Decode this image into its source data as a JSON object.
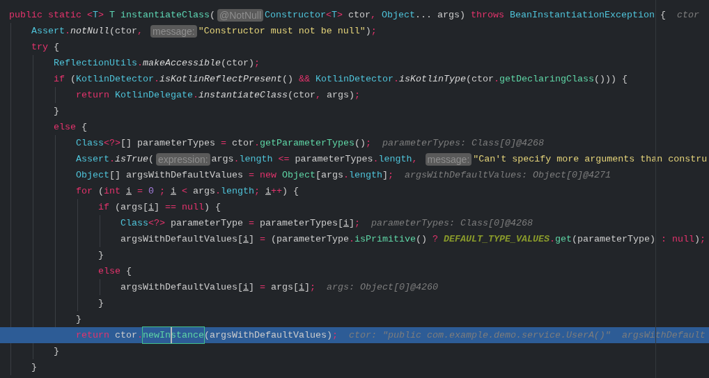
{
  "editor": {
    "lines": [
      {
        "current": false,
        "tokens": [
          {
            "kind": "kw",
            "text": "public static "
          },
          {
            "kind": "punct",
            "text": "<"
          },
          {
            "kind": "type",
            "text": "T"
          },
          {
            "kind": "punct",
            "text": "> "
          },
          {
            "kind": "decl",
            "text": "T instantiateClass"
          },
          {
            "kind": "plain",
            "text": "("
          },
          {
            "kind": "hint",
            "text": "@NotNull"
          },
          {
            "kind": "type",
            "text": "Constructor"
          },
          {
            "kind": "punct",
            "text": "<"
          },
          {
            "kind": "type",
            "text": "T"
          },
          {
            "kind": "punct",
            "text": "> "
          },
          {
            "kind": "plain",
            "text": "ctor"
          },
          {
            "kind": "punct",
            "text": ", "
          },
          {
            "kind": "type",
            "text": "Object"
          },
          {
            "kind": "plain",
            "text": "... args) "
          },
          {
            "kind": "kw",
            "text": "throws "
          },
          {
            "kind": "type",
            "text": "BeanInstantiationException"
          },
          {
            "kind": "plain",
            "text": " {"
          },
          {
            "kind": "debug",
            "text": "ctor"
          }
        ],
        "children": [
          {
            "current": false,
            "tokens": [
              {
                "kind": "type",
                "text": "Assert"
              },
              {
                "kind": "punct",
                "text": "."
              },
              {
                "kind": "static",
                "text": "notNull"
              },
              {
                "kind": "plain",
                "text": "(ctor"
              },
              {
                "kind": "punct",
                "text": ", "
              },
              {
                "kind": "hint",
                "text": "message:"
              },
              {
                "kind": "string",
                "text": "\"Constructor must not be null\""
              },
              {
                "kind": "plain",
                "text": ")"
              },
              {
                "kind": "punct",
                "text": ";"
              }
            ]
          },
          {
            "current": false,
            "tokens": [
              {
                "kind": "kw",
                "text": "try "
              },
              {
                "kind": "plain",
                "text": "{"
              }
            ],
            "children": [
              {
                "current": false,
                "tokens": [
                  {
                    "kind": "type",
                    "text": "ReflectionUtils"
                  },
                  {
                    "kind": "punct",
                    "text": "."
                  },
                  {
                    "kind": "static",
                    "text": "makeAccessible"
                  },
                  {
                    "kind": "plain",
                    "text": "(ctor)"
                  },
                  {
                    "kind": "punct",
                    "text": ";"
                  }
                ]
              },
              {
                "current": false,
                "tokens": [
                  {
                    "kind": "kw",
                    "text": "if "
                  },
                  {
                    "kind": "plain",
                    "text": "("
                  },
                  {
                    "kind": "type",
                    "text": "KotlinDetector"
                  },
                  {
                    "kind": "punct",
                    "text": "."
                  },
                  {
                    "kind": "static",
                    "text": "isKotlinReflectPresent"
                  },
                  {
                    "kind": "plain",
                    "text": "() "
                  },
                  {
                    "kind": "kw",
                    "text": "&& "
                  },
                  {
                    "kind": "type",
                    "text": "KotlinDetector"
                  },
                  {
                    "kind": "punct",
                    "text": "."
                  },
                  {
                    "kind": "static",
                    "text": "isKotlinType"
                  },
                  {
                    "kind": "plain",
                    "text": "(ctor"
                  },
                  {
                    "kind": "punct",
                    "text": "."
                  },
                  {
                    "kind": "method",
                    "text": "getDeclaringClass"
                  },
                  {
                    "kind": "plain",
                    "text": "())) {"
                  }
                ],
                "children": [
                  {
                    "current": false,
                    "tokens": [
                      {
                        "kind": "kw",
                        "text": "return "
                      },
                      {
                        "kind": "type",
                        "text": "KotlinDelegate"
                      },
                      {
                        "kind": "punct",
                        "text": "."
                      },
                      {
                        "kind": "static",
                        "text": "instantiateClass"
                      },
                      {
                        "kind": "plain",
                        "text": "(ctor"
                      },
                      {
                        "kind": "punct",
                        "text": ", "
                      },
                      {
                        "kind": "plain",
                        "text": "args)"
                      },
                      {
                        "kind": "punct",
                        "text": ";"
                      }
                    ]
                  }
                ]
              },
              {
                "current": false,
                "tokens": [
                  {
                    "kind": "plain",
                    "text": "}"
                  }
                ]
              },
              {
                "current": false,
                "tokens": [
                  {
                    "kind": "kw",
                    "text": "else "
                  },
                  {
                    "kind": "plain",
                    "text": "{"
                  }
                ],
                "children": [
                  {
                    "current": false,
                    "tokens": [
                      {
                        "kind": "type",
                        "text": "Class"
                      },
                      {
                        "kind": "punct",
                        "text": "<?>"
                      },
                      {
                        "kind": "plain",
                        "text": "[] parameterTypes "
                      },
                      {
                        "kind": "punct",
                        "text": "= "
                      },
                      {
                        "kind": "plain",
                        "text": "ctor"
                      },
                      {
                        "kind": "punct",
                        "text": "."
                      },
                      {
                        "kind": "method",
                        "text": "getParameterTypes"
                      },
                      {
                        "kind": "plain",
                        "text": "()"
                      },
                      {
                        "kind": "punct",
                        "text": ";"
                      },
                      {
                        "kind": "debug",
                        "text": "parameterTypes: Class[0]@4268"
                      }
                    ]
                  },
                  {
                    "current": false,
                    "tokens": [
                      {
                        "kind": "type",
                        "text": "Assert"
                      },
                      {
                        "kind": "punct",
                        "text": "."
                      },
                      {
                        "kind": "static",
                        "text": "isTrue"
                      },
                      {
                        "kind": "plain",
                        "text": "("
                      },
                      {
                        "kind": "hint",
                        "text": "expression:"
                      },
                      {
                        "kind": "plain",
                        "text": "args"
                      },
                      {
                        "kind": "punct",
                        "text": "."
                      },
                      {
                        "kind": "field",
                        "text": "length "
                      },
                      {
                        "kind": "punct",
                        "text": "<= "
                      },
                      {
                        "kind": "plain",
                        "text": "parameterTypes"
                      },
                      {
                        "kind": "punct",
                        "text": "."
                      },
                      {
                        "kind": "field",
                        "text": "length"
                      },
                      {
                        "kind": "punct",
                        "text": ", "
                      },
                      {
                        "kind": "hint",
                        "text": "message:"
                      },
                      {
                        "kind": "string",
                        "text": "\"Can't specify more arguments than constru"
                      }
                    ]
                  },
                  {
                    "current": false,
                    "tokens": [
                      {
                        "kind": "type",
                        "text": "Object"
                      },
                      {
                        "kind": "plain",
                        "text": "[] argsWithDefaultValues "
                      },
                      {
                        "kind": "punct",
                        "text": "= "
                      },
                      {
                        "kind": "kw",
                        "text": "new "
                      },
                      {
                        "kind": "method",
                        "text": "Object"
                      },
                      {
                        "kind": "plain",
                        "text": "[args"
                      },
                      {
                        "kind": "punct",
                        "text": "."
                      },
                      {
                        "kind": "field",
                        "text": "length"
                      },
                      {
                        "kind": "plain",
                        "text": "]"
                      },
                      {
                        "kind": "punct",
                        "text": ";"
                      },
                      {
                        "kind": "debug",
                        "text": "argsWithDefaultValues: Object[0]@4271"
                      }
                    ]
                  },
                  {
                    "current": false,
                    "tokens": [
                      {
                        "kind": "kw",
                        "text": "for "
                      },
                      {
                        "kind": "plain",
                        "text": "("
                      },
                      {
                        "kind": "kw",
                        "text": "int "
                      },
                      {
                        "kind": "var",
                        "text": "i"
                      },
                      {
                        "kind": "punct",
                        "text": " = "
                      },
                      {
                        "kind": "num",
                        "text": "0"
                      },
                      {
                        "kind": "punct",
                        "text": " ; "
                      },
                      {
                        "kind": "var",
                        "text": "i"
                      },
                      {
                        "kind": "punct",
                        "text": " < "
                      },
                      {
                        "kind": "plain",
                        "text": "args"
                      },
                      {
                        "kind": "punct",
                        "text": "."
                      },
                      {
                        "kind": "field",
                        "text": "length"
                      },
                      {
                        "kind": "punct",
                        "text": "; "
                      },
                      {
                        "kind": "var",
                        "text": "i"
                      },
                      {
                        "kind": "punct",
                        "text": "++"
                      },
                      {
                        "kind": "plain",
                        "text": ") {"
                      }
                    ],
                    "children": [
                      {
                        "current": false,
                        "tokens": [
                          {
                            "kind": "kw",
                            "text": "if "
                          },
                          {
                            "kind": "plain",
                            "text": "(args["
                          },
                          {
                            "kind": "var",
                            "text": "i"
                          },
                          {
                            "kind": "plain",
                            "text": "] "
                          },
                          {
                            "kind": "punct",
                            "text": "== "
                          },
                          {
                            "kind": "kw",
                            "text": "null"
                          },
                          {
                            "kind": "plain",
                            "text": ") {"
                          }
                        ],
                        "children": [
                          {
                            "current": false,
                            "tokens": [
                              {
                                "kind": "type",
                                "text": "Class"
                              },
                              {
                                "kind": "punct",
                                "text": "<?> "
                              },
                              {
                                "kind": "plain",
                                "text": "parameterType "
                              },
                              {
                                "kind": "punct",
                                "text": "= "
                              },
                              {
                                "kind": "plain",
                                "text": "parameterTypes["
                              },
                              {
                                "kind": "var",
                                "text": "i"
                              },
                              {
                                "kind": "plain",
                                "text": "]"
                              },
                              {
                                "kind": "punct",
                                "text": ";"
                              },
                              {
                                "kind": "debug",
                                "text": "parameterTypes: Class[0]@4268"
                              }
                            ]
                          },
                          {
                            "current": false,
                            "tokens": [
                              {
                                "kind": "plain",
                                "text": "argsWithDefaultValues["
                              },
                              {
                                "kind": "var",
                                "text": "i"
                              },
                              {
                                "kind": "plain",
                                "text": "] "
                              },
                              {
                                "kind": "punct",
                                "text": "= "
                              },
                              {
                                "kind": "plain",
                                "text": "(parameterType"
                              },
                              {
                                "kind": "punct",
                                "text": "."
                              },
                              {
                                "kind": "method",
                                "text": "isPrimitive"
                              },
                              {
                                "kind": "plain",
                                "text": "() "
                              },
                              {
                                "kind": "punct",
                                "text": "? "
                              },
                              {
                                "kind": "const",
                                "text": "DEFAULT_TYPE_VALUES"
                              },
                              {
                                "kind": "punct",
                                "text": "."
                              },
                              {
                                "kind": "method",
                                "text": "get"
                              },
                              {
                                "kind": "plain",
                                "text": "(parameterType) "
                              },
                              {
                                "kind": "punct",
                                "text": ": null"
                              },
                              {
                                "kind": "plain",
                                "text": ")"
                              },
                              {
                                "kind": "punct",
                                "text": ";"
                              }
                            ]
                          }
                        ]
                      },
                      {
                        "current": false,
                        "tokens": [
                          {
                            "kind": "plain",
                            "text": "}"
                          }
                        ]
                      },
                      {
                        "current": false,
                        "tokens": [
                          {
                            "kind": "kw",
                            "text": "else "
                          },
                          {
                            "kind": "plain",
                            "text": "{"
                          }
                        ],
                        "children": [
                          {
                            "current": false,
                            "tokens": [
                              {
                                "kind": "plain",
                                "text": "argsWithDefaultValues["
                              },
                              {
                                "kind": "var",
                                "text": "i"
                              },
                              {
                                "kind": "plain",
                                "text": "] "
                              },
                              {
                                "kind": "punct",
                                "text": "= "
                              },
                              {
                                "kind": "plain",
                                "text": "args["
                              },
                              {
                                "kind": "var",
                                "text": "i"
                              },
                              {
                                "kind": "plain",
                                "text": "]"
                              },
                              {
                                "kind": "punct",
                                "text": ";"
                              },
                              {
                                "kind": "debug",
                                "text": "args: Object[0]@4260"
                              }
                            ]
                          }
                        ]
                      },
                      {
                        "current": false,
                        "tokens": [
                          {
                            "kind": "plain",
                            "text": "}"
                          }
                        ]
                      }
                    ]
                  },
                  {
                    "current": false,
                    "tokens": [
                      {
                        "kind": "plain",
                        "text": "}"
                      }
                    ]
                  },
                  {
                    "current": true,
                    "tokens": [
                      {
                        "kind": "kw",
                        "text": "return "
                      },
                      {
                        "kind": "plain",
                        "text": "ctor"
                      },
                      {
                        "kind": "punct",
                        "text": "."
                      },
                      {
                        "kind": "match",
                        "text": "newInstance"
                      },
                      {
                        "kind": "plain",
                        "text": "(argsWithDefaultValues)"
                      },
                      {
                        "kind": "punct",
                        "text": ";"
                      },
                      {
                        "kind": "debug",
                        "text": "ctor: \"public com.example.demo.service.UserA()\""
                      },
                      {
                        "kind": "debug",
                        "text": "argsWithDefault"
                      }
                    ]
                  }
                ]
              },
              {
                "current": false,
                "tokens": [
                  {
                    "kind": "plain",
                    "text": "}"
                  }
                ]
              }
            ]
          },
          {
            "current": false,
            "tokens": [
              {
                "kind": "plain",
                "text": "}"
              }
            ]
          }
        ]
      }
    ]
  }
}
